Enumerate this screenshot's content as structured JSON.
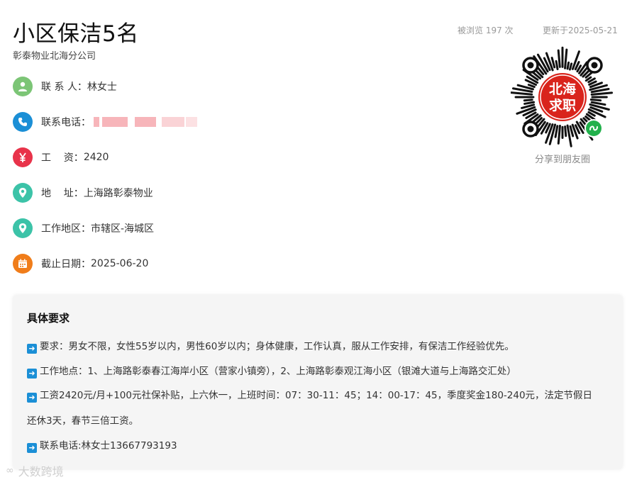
{
  "job": {
    "title": "小区保洁5名",
    "company": "彰泰物业北海分公司",
    "views": "被浏览 197 次",
    "updated": "更新于2025-05-21"
  },
  "info": {
    "contact_label": "联 系 人：",
    "contact_value": "林女士",
    "phone_label": "联系电话：",
    "salary_label": "工    资：",
    "salary_value": "2420",
    "address_label": "地    址：",
    "address_value": "上海路彰泰物业",
    "area_label": "工作地区：",
    "area_value": "市辖区-海城区",
    "deadline_label": "截止日期：",
    "deadline_value": "2025-06-20"
  },
  "qr": {
    "logo_text_1": "北海",
    "logo_text_2": "求职",
    "caption": "分享到朋友圈"
  },
  "requirements": {
    "title": "具体要求",
    "line1": "要求：男女不限，女性55岁以内，男性60岁以内；身体健康，工作认真，服从工作安排，有保洁工作经验优先。",
    "line2": "工作地点：1、上海路彰泰春江海岸小区（营家小镇旁），2、上海路彰泰观江海小区（银滩大道与上海路交汇处）",
    "line3a": "工资2420元/月+100元社保补贴，上六休一，上班时间：07：30-11：45；14：00-17：45，季度奖金180-240元，法定节假日",
    "line3b": "还休3天，春节三倍工资。",
    "line4": "联系电话:林女士13667793193"
  },
  "watermark": {
    "text": "大数跨境"
  },
  "colors": {
    "contact_icon": "#7cc576",
    "phone_icon": "#1b8fd6",
    "salary_icon": "#e8334a",
    "address_icon": "#3cc3a8",
    "deadline_icon": "#f07d1a",
    "arrow_icon": "#1b8fd6",
    "qr_center": "#d9241c",
    "mini_program_badge": "#22b14c"
  },
  "icons": {
    "contact": "person-icon",
    "phone": "phone-icon",
    "salary": "yen-icon",
    "address": "location-pin-icon",
    "area": "location-pin-icon",
    "deadline": "calendar-icon",
    "arrow": "right-arrow-icon"
  }
}
